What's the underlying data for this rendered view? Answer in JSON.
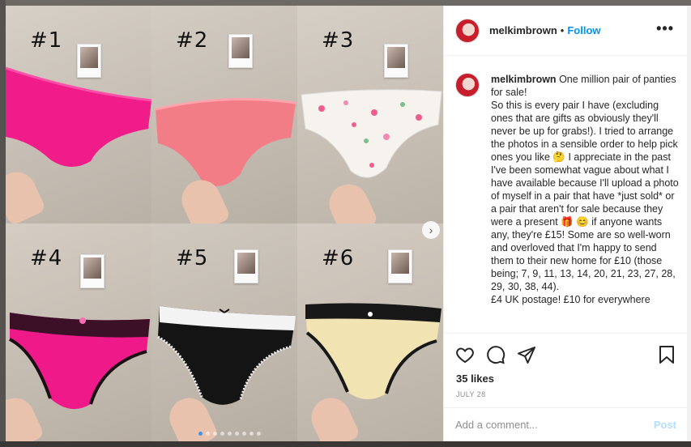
{
  "post": {
    "username": "melkimbrown",
    "separator": "•",
    "follow_label": "Follow",
    "more_label": "•••",
    "caption_username": "melkimbrown",
    "caption_text": "One million pair of panties for sale!\nSo this is every pair I have (excluding ones that are gifts as obviously they'll never be up for grabs!). I tried to arrange the photos in a sensible order to help pick ones you like 🤔 I appreciate in the past I've been somewhat vague about what I have available because I'll upload a photo of myself in a pair that have *just sold* or a pair that aren't for sale because they were a present 🎁 😊 if anyone wants any, they're £15! Some are so well-worn and overloved that I'm happy to send them to their new home for £10 (those being; 7, 9, 11, 13, 14, 20, 21, 23, 27, 28, 29, 30, 38, 44).\n£4 UK postage! £10 for everywhere",
    "likes": "35 likes",
    "date": "JULY 28",
    "comment_placeholder": "Add a comment...",
    "post_label": "Post"
  },
  "photo": {
    "labels": [
      "#1",
      "#2",
      "#3",
      "#4",
      "#5",
      "#6"
    ],
    "carousel_next": "›",
    "dots_count": 9,
    "active_dot": 1
  },
  "colors": {
    "follow": "#0095f6",
    "post_disabled": "#b2dffc",
    "pant_1": "#f01c8a",
    "pant_2": "#f27d86",
    "pant_3": "#f6f2ee",
    "pant_4": "#f0198a",
    "pant_5": "#141414",
    "pant_6": "#f1e3b2"
  },
  "icons": [
    "heart-icon",
    "comment-icon",
    "share-icon",
    "bookmark-icon",
    "more-icon"
  ]
}
